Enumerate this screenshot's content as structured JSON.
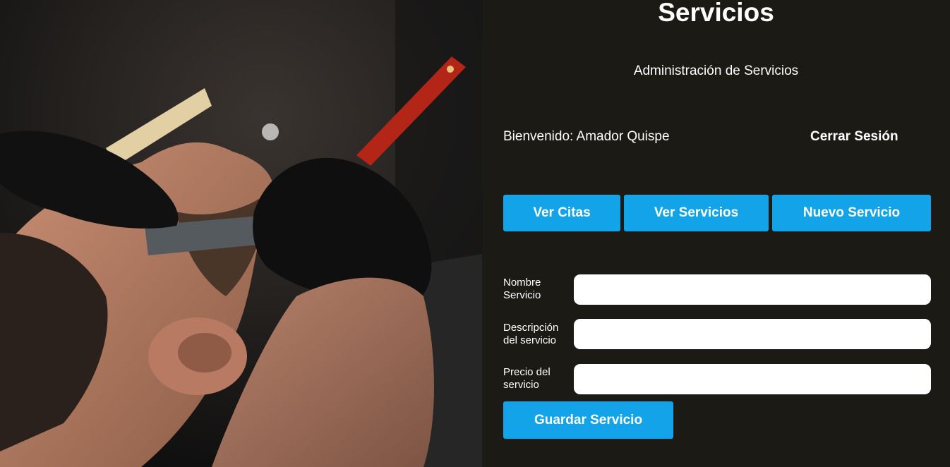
{
  "header": {
    "title": "Servicios",
    "subtitle": "Administración de Servicios"
  },
  "user": {
    "welcome": "Bienvenido: Amador Quispe",
    "logout_label": "Cerrar Sesión"
  },
  "nav": {
    "buttons": [
      {
        "label": "Ver Citas"
      },
      {
        "label": "Ver Servicios"
      },
      {
        "label": "Nuevo Servicio"
      }
    ]
  },
  "form": {
    "fields": [
      {
        "label": "Nombre Servicio",
        "value": ""
      },
      {
        "label": "Descripción del servicio",
        "value": ""
      },
      {
        "label": "Precio del servicio",
        "value": ""
      }
    ],
    "submit_label": "Guardar Servicio"
  },
  "colors": {
    "panel_background": "#1b1a15",
    "accent": "#12a3e8"
  }
}
